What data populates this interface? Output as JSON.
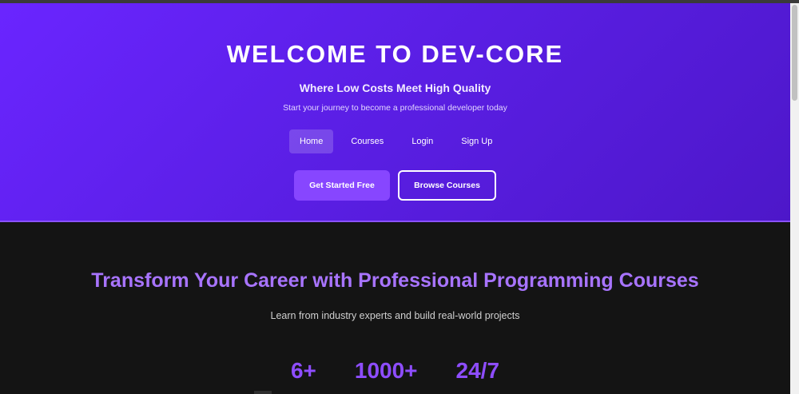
{
  "hero": {
    "title": "WELCOME TO DEV-CORE",
    "subtitle": "Where Low Costs Meet High Quality",
    "tagline": "Start your journey to become a professional developer today",
    "nav": [
      {
        "label": "Home",
        "active": true
      },
      {
        "label": "Courses",
        "active": false
      },
      {
        "label": "Login",
        "active": false
      },
      {
        "label": "Sign Up",
        "active": false
      }
    ],
    "cta_primary": "Get Started Free",
    "cta_secondary": "Browse Courses"
  },
  "section": {
    "title": "Transform Your Career with Professional Programming Courses",
    "description": "Learn from industry experts and build real-world projects",
    "stats": [
      "6+",
      "1000+",
      "24/7"
    ]
  },
  "colors": {
    "hero_start": "#6a25ff",
    "hero_end": "#4d17c9",
    "accent": "#8746ff",
    "heading_purple": "#a874ff",
    "dark_bg": "#141414"
  }
}
